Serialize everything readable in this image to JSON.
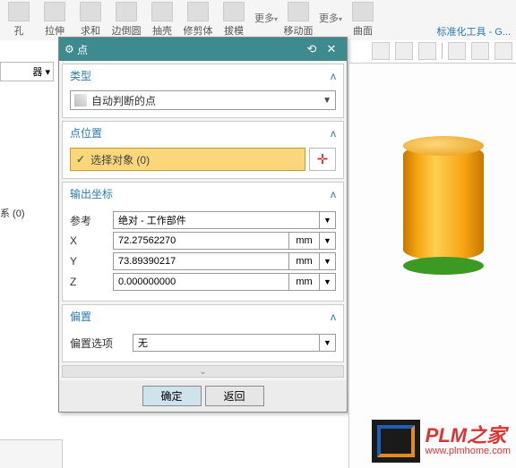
{
  "ribbon": {
    "items": [
      "孔",
      "拉伸",
      "求和",
      "边倒圆",
      "抽壳",
      "修剪体",
      "拔模",
      "更多",
      "移动面",
      "更多",
      "曲面"
    ],
    "toolLink": "标准化工具 - G..."
  },
  "leftFrag1": "器",
  "leftFrag2": "系 (0)",
  "dialog": {
    "title": "点",
    "sections": {
      "type": {
        "header": "类型",
        "combo": "自动判断的点"
      },
      "position": {
        "header": "点位置",
        "select": "选择对象 (0)"
      },
      "output": {
        "header": "输出坐标",
        "refLabel": "参考",
        "refValue": "绝对 - 工作部件",
        "xLabel": "X",
        "xValue": "72.27562270",
        "xUnit": "mm",
        "yLabel": "Y",
        "yValue": "73.89390217",
        "yUnit": "mm",
        "zLabel": "Z",
        "zValue": "0.000000000",
        "zUnit": "mm"
      },
      "offset": {
        "header": "偏置",
        "optLabel": "偏置选项",
        "optValue": "无"
      }
    },
    "ok": "确定",
    "back": "返回"
  },
  "watermark": {
    "brand": "PLM之家",
    "url": "www.plmhome.com"
  }
}
